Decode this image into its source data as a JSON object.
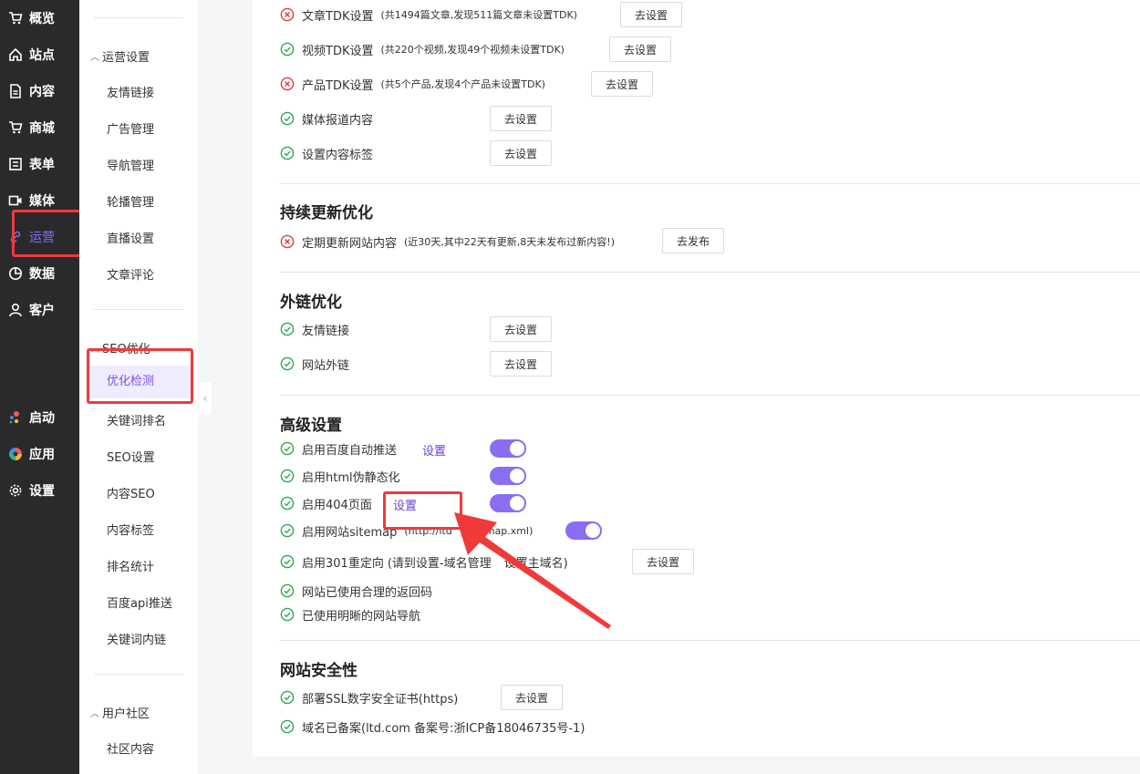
{
  "nav": {
    "items": [
      {
        "label": "概览",
        "icon": "cart-icon"
      },
      {
        "label": "站点",
        "icon": "home-icon"
      },
      {
        "label": "内容",
        "icon": "document-icon"
      },
      {
        "label": "商城",
        "icon": "shop-icon"
      },
      {
        "label": "表单",
        "icon": "form-icon"
      },
      {
        "label": "媒体",
        "icon": "video-icon"
      },
      {
        "label": "运营",
        "icon": "link-icon",
        "active": true
      },
      {
        "label": "数据",
        "icon": "pie-chart-icon"
      },
      {
        "label": "客户",
        "icon": "user-icon"
      },
      {
        "label": "启动",
        "icon": "launch-icon"
      },
      {
        "label": "应用",
        "icon": "apps-icon"
      },
      {
        "label": "设置",
        "icon": "gear-icon"
      }
    ]
  },
  "submenu": {
    "groups": [
      {
        "title": "运营设置",
        "items": [
          "友情链接",
          "广告管理",
          "导航管理",
          "轮播管理",
          "直播设置",
          "文章评论"
        ]
      },
      {
        "title": "SEO优化",
        "items": [
          "优化检测",
          "关键词排名",
          "SEO设置",
          "内容SEO",
          "内容标签",
          "排名统计",
          "百度api推送",
          "关键词内链"
        ]
      },
      {
        "title": "用户社区",
        "items": [
          "社区内容"
        ]
      }
    ],
    "active_item": "优化检测"
  },
  "content_rows": [
    {
      "label": "文章TDK设置",
      "note": "(共1494篇文章,发现511篇文章未设置TDK)",
      "status": "error",
      "button": "去设置"
    },
    {
      "label": "视频TDK设置",
      "note": "(共220个视频,发现49个视频未设置TDK)",
      "status": "ok",
      "button": "去设置"
    },
    {
      "label": "产品TDK设置",
      "note": "(共5个产品,发现4个产品未设置TDK)",
      "status": "error",
      "button": "去设置"
    },
    {
      "label": "媒体报道内容",
      "note": "",
      "status": "ok",
      "button": "去设置"
    },
    {
      "label": "设置内容标签",
      "note": "",
      "status": "ok",
      "button": "去设置"
    }
  ],
  "sections": {
    "continuous": {
      "title": "持续更新优化",
      "rows": [
        {
          "label": "定期更新网站内容",
          "note": "(近30天,其中22天有更新,8天未发布过新内容!)",
          "status": "error",
          "button": "去发布"
        }
      ]
    },
    "backlinks": {
      "title": "外链优化",
      "rows": [
        {
          "label": "友情链接",
          "status": "ok",
          "button": "去设置"
        },
        {
          "label": "网站外链",
          "status": "ok",
          "button": "去设置"
        }
      ]
    },
    "advanced": {
      "title": "高级设置",
      "rows": [
        {
          "label": "启用百度自动推送",
          "status": "ok",
          "link": "设置",
          "toggle": true
        },
        {
          "label": "启用html伪静态化",
          "status": "ok",
          "toggle": true
        },
        {
          "label": "启用404页面",
          "status": "ok",
          "link": "设置",
          "toggle": true
        },
        {
          "label": "启用网站sitemap",
          "note_left": "(http://ltd",
          "note_right": "itemap.xml)",
          "status": "ok",
          "toggle": true
        },
        {
          "label": "启用301重定向",
          "note_left": "(请到设置-域名管理",
          "note_right": "设置主域名)",
          "status": "ok",
          "button": "去设置"
        },
        {
          "label": "网站已使用合理的返回码",
          "status": "ok"
        },
        {
          "label": "已使用明晰的网站导航",
          "status": "ok"
        }
      ]
    },
    "security": {
      "title": "网站安全性",
      "rows": [
        {
          "label": "部署SSL数字安全证书(https)",
          "status": "ok",
          "button": "去设置"
        },
        {
          "label": "域名已备案(ltd.com 备案号:浙ICP备18046735号-1)",
          "status": "ok"
        }
      ]
    }
  },
  "colors": {
    "ok": "#2fa84f",
    "error": "#e23c3c",
    "accent": "#8a6df0",
    "highlight": "#f03a3a"
  }
}
